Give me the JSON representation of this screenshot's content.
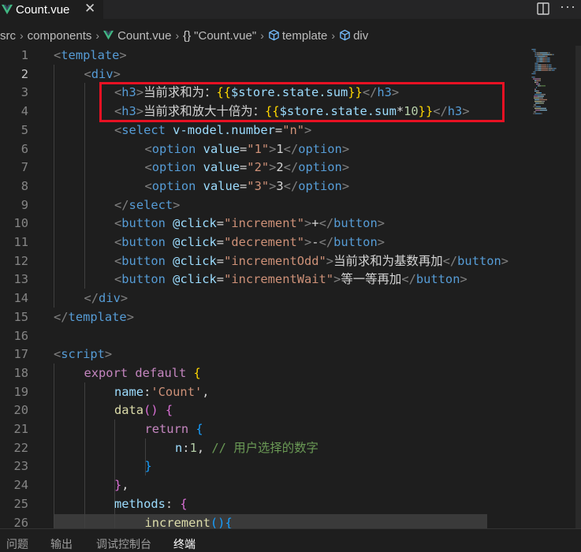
{
  "tab": {
    "file_name": "Count.vue",
    "close_glyph": "✕"
  },
  "breadcrumb": {
    "items": [
      "src",
      "components",
      "Count.vue",
      "\"Count.vue\"",
      "template",
      "div"
    ],
    "braces": "{}",
    "separator": "›"
  },
  "editor": {
    "active_line": 2,
    "lines": [
      {
        "n": "1",
        "indent": 0,
        "tokens": [
          [
            "b",
            "<"
          ],
          [
            "g",
            "template"
          ],
          [
            "b",
            ">"
          ]
        ]
      },
      {
        "n": "2",
        "indent": 1,
        "tokens": [
          [
            "b",
            "<"
          ],
          [
            "g",
            "div"
          ],
          [
            "b",
            ">"
          ]
        ]
      },
      {
        "n": "3",
        "indent": 2,
        "tokens": [
          [
            "b",
            "<"
          ],
          [
            "g",
            "h3"
          ],
          [
            "b",
            ">"
          ],
          [
            "x",
            "当前求和为："
          ],
          [
            "m",
            "{{"
          ],
          [
            "v",
            "$store.state.sum"
          ],
          [
            "m",
            "}}"
          ],
          [
            "b",
            "</"
          ],
          [
            "g",
            "h3"
          ],
          [
            "b",
            ">"
          ]
        ]
      },
      {
        "n": "4",
        "indent": 2,
        "tokens": [
          [
            "b",
            "<"
          ],
          [
            "g",
            "h3"
          ],
          [
            "b",
            ">"
          ],
          [
            "x",
            "当前求和放大十倍为："
          ],
          [
            "m",
            "{{"
          ],
          [
            "v",
            "$store.state.sum"
          ],
          [
            "x",
            "*"
          ],
          [
            "u",
            "10"
          ],
          [
            "m",
            "}}"
          ],
          [
            "b",
            "</"
          ],
          [
            "g",
            "h3"
          ],
          [
            "b",
            ">"
          ]
        ]
      },
      {
        "n": "5",
        "indent": 2,
        "tokens": [
          [
            "b",
            "<"
          ],
          [
            "g",
            "select"
          ],
          [
            "x",
            " "
          ],
          [
            "a",
            "v-model.number"
          ],
          [
            "x",
            "="
          ],
          [
            "s",
            "\"n\""
          ],
          [
            "b",
            ">"
          ]
        ]
      },
      {
        "n": "6",
        "indent": 3,
        "tokens": [
          [
            "b",
            "<"
          ],
          [
            "g",
            "option"
          ],
          [
            "x",
            " "
          ],
          [
            "a",
            "value"
          ],
          [
            "x",
            "="
          ],
          [
            "s",
            "\"1\""
          ],
          [
            "b",
            ">"
          ],
          [
            "x",
            "1"
          ],
          [
            "b",
            "</"
          ],
          [
            "g",
            "option"
          ],
          [
            "b",
            ">"
          ]
        ]
      },
      {
        "n": "7",
        "indent": 3,
        "tokens": [
          [
            "b",
            "<"
          ],
          [
            "g",
            "option"
          ],
          [
            "x",
            " "
          ],
          [
            "a",
            "value"
          ],
          [
            "x",
            "="
          ],
          [
            "s",
            "\"2\""
          ],
          [
            "b",
            ">"
          ],
          [
            "x",
            "2"
          ],
          [
            "b",
            "</"
          ],
          [
            "g",
            "option"
          ],
          [
            "b",
            ">"
          ]
        ]
      },
      {
        "n": "8",
        "indent": 3,
        "tokens": [
          [
            "b",
            "<"
          ],
          [
            "g",
            "option"
          ],
          [
            "x",
            " "
          ],
          [
            "a",
            "value"
          ],
          [
            "x",
            "="
          ],
          [
            "s",
            "\"3\""
          ],
          [
            "b",
            ">"
          ],
          [
            "x",
            "3"
          ],
          [
            "b",
            "</"
          ],
          [
            "g",
            "option"
          ],
          [
            "b",
            ">"
          ]
        ]
      },
      {
        "n": "9",
        "indent": 2,
        "tokens": [
          [
            "b",
            "</"
          ],
          [
            "g",
            "select"
          ],
          [
            "b",
            ">"
          ]
        ]
      },
      {
        "n": "10",
        "indent": 2,
        "tokens": [
          [
            "b",
            "<"
          ],
          [
            "g",
            "button"
          ],
          [
            "x",
            " "
          ],
          [
            "a",
            "@click"
          ],
          [
            "x",
            "="
          ],
          [
            "s",
            "\"increment\""
          ],
          [
            "b",
            ">"
          ],
          [
            "x",
            "+"
          ],
          [
            "b",
            "</"
          ],
          [
            "g",
            "button"
          ],
          [
            "b",
            ">"
          ]
        ]
      },
      {
        "n": "11",
        "indent": 2,
        "tokens": [
          [
            "b",
            "<"
          ],
          [
            "g",
            "button"
          ],
          [
            "x",
            " "
          ],
          [
            "a",
            "@click"
          ],
          [
            "x",
            "="
          ],
          [
            "s",
            "\"decrement\""
          ],
          [
            "b",
            ">"
          ],
          [
            "x",
            "-"
          ],
          [
            "b",
            "</"
          ],
          [
            "g",
            "button"
          ],
          [
            "b",
            ">"
          ]
        ]
      },
      {
        "n": "12",
        "indent": 2,
        "tokens": [
          [
            "b",
            "<"
          ],
          [
            "g",
            "button"
          ],
          [
            "x",
            " "
          ],
          [
            "a",
            "@click"
          ],
          [
            "x",
            "="
          ],
          [
            "s",
            "\"incrementOdd\""
          ],
          [
            "b",
            ">"
          ],
          [
            "x",
            "当前求和为基数再加"
          ],
          [
            "b",
            "</"
          ],
          [
            "g",
            "button"
          ],
          [
            "b",
            ">"
          ]
        ]
      },
      {
        "n": "13",
        "indent": 2,
        "tokens": [
          [
            "b",
            "<"
          ],
          [
            "g",
            "button"
          ],
          [
            "x",
            " "
          ],
          [
            "a",
            "@click"
          ],
          [
            "x",
            "="
          ],
          [
            "s",
            "\"incrementWait\""
          ],
          [
            "b",
            ">"
          ],
          [
            "x",
            "等一等再加"
          ],
          [
            "b",
            "</"
          ],
          [
            "g",
            "button"
          ],
          [
            "b",
            ">"
          ]
        ]
      },
      {
        "n": "14",
        "indent": 1,
        "tokens": [
          [
            "b",
            "</"
          ],
          [
            "g",
            "div"
          ],
          [
            "b",
            ">"
          ]
        ]
      },
      {
        "n": "15",
        "indent": 0,
        "tokens": [
          [
            "b",
            "</"
          ],
          [
            "g",
            "template"
          ],
          [
            "b",
            ">"
          ]
        ]
      },
      {
        "n": "16",
        "indent": 0,
        "tokens": []
      },
      {
        "n": "17",
        "indent": 0,
        "tokens": [
          [
            "b",
            "<"
          ],
          [
            "g",
            "script"
          ],
          [
            "b",
            ">"
          ]
        ]
      },
      {
        "n": "18",
        "indent": 1,
        "tokens": [
          [
            "k",
            "export"
          ],
          [
            "x",
            " "
          ],
          [
            "k",
            "default"
          ],
          [
            "x",
            " "
          ],
          [
            "p1",
            "{"
          ]
        ]
      },
      {
        "n": "19",
        "indent": 2,
        "tokens": [
          [
            "v",
            "name"
          ],
          [
            "x",
            ":"
          ],
          [
            "s",
            "'Count'"
          ],
          [
            "x",
            ","
          ]
        ]
      },
      {
        "n": "20",
        "indent": 2,
        "tokens": [
          [
            "f",
            "data"
          ],
          [
            "p2",
            "()"
          ],
          [
            "x",
            " "
          ],
          [
            "p2",
            "{"
          ]
        ]
      },
      {
        "n": "21",
        "indent": 3,
        "tokens": [
          [
            "k",
            "return"
          ],
          [
            "x",
            " "
          ],
          [
            "p3",
            "{"
          ]
        ]
      },
      {
        "n": "22",
        "indent": 4,
        "tokens": [
          [
            "v",
            "n"
          ],
          [
            "x",
            ":"
          ],
          [
            "u",
            "1"
          ],
          [
            "x",
            ", "
          ],
          [
            "c",
            "// 用户选择的数字"
          ]
        ]
      },
      {
        "n": "23",
        "indent": 3,
        "tokens": [
          [
            "p3",
            "}"
          ]
        ]
      },
      {
        "n": "24",
        "indent": 2,
        "tokens": [
          [
            "p2",
            "}"
          ],
          [
            "x",
            ","
          ]
        ]
      },
      {
        "n": "25",
        "indent": 2,
        "tokens": [
          [
            "v",
            "methods"
          ],
          [
            "x",
            ": "
          ],
          [
            "p2",
            "{"
          ]
        ]
      },
      {
        "n": "26",
        "indent": 3,
        "tokens": [
          [
            "f",
            "increment"
          ],
          [
            "p3",
            "(){"
          ]
        ]
      }
    ]
  },
  "panel": {
    "tabs": [
      "问题",
      "输出",
      "调试控制台",
      "终端"
    ],
    "active": "终端"
  },
  "colors": {
    "background": "#1e1e1e",
    "highlight_box": "#e81123",
    "tag": "#569cd6",
    "attribute": "#9cdcfe",
    "string": "#ce9178"
  }
}
